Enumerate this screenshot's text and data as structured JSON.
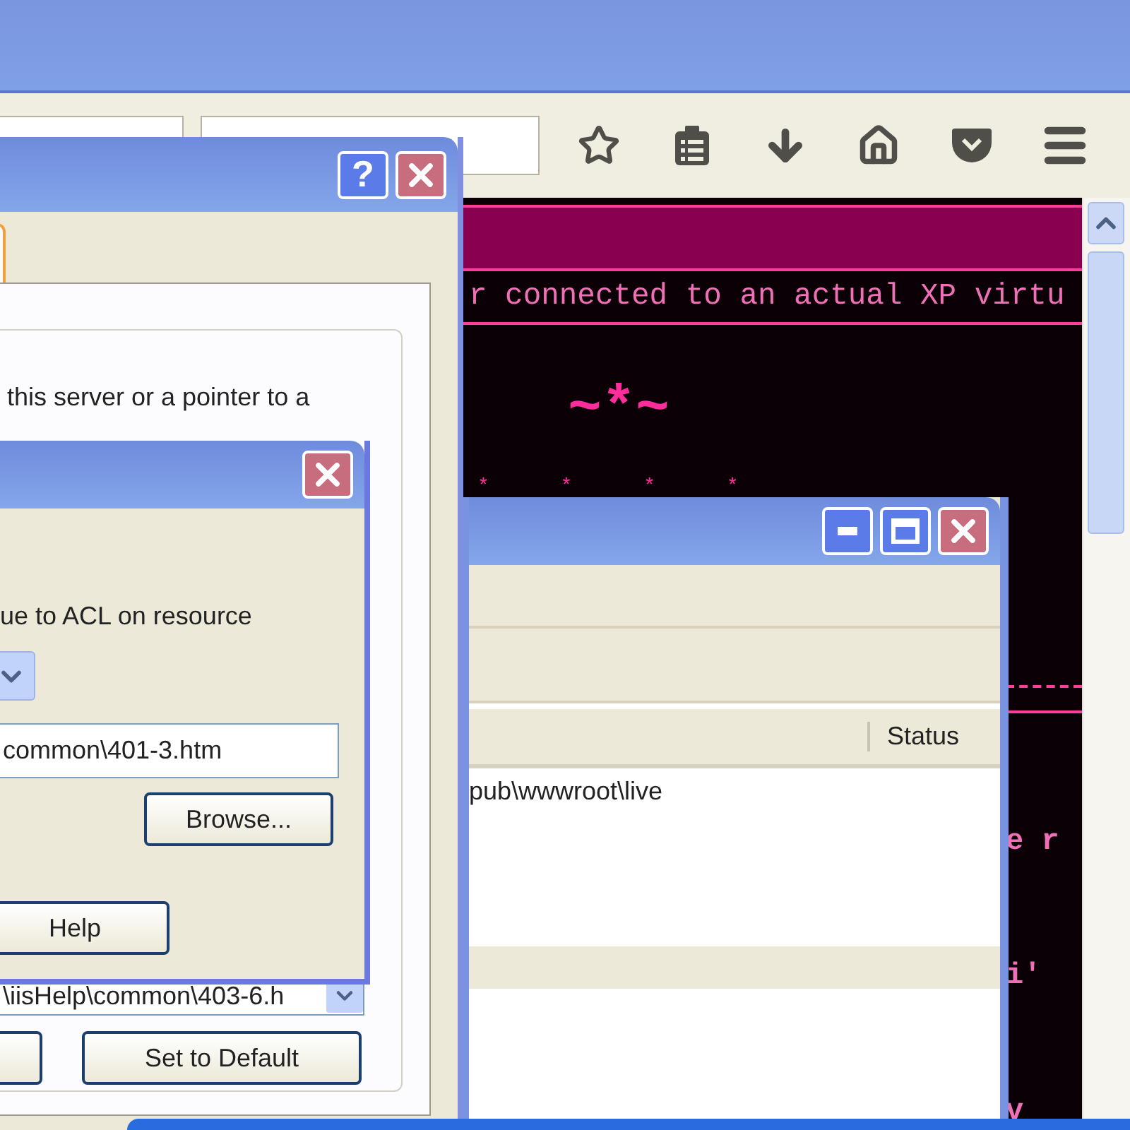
{
  "page": {
    "banner_text": "r connected to an actual XP virtu",
    "art": "~*~",
    "stars": "*      *      *      *",
    "fragments": [
      "e r",
      "i'",
      "v"
    ]
  },
  "properties_dialog": {
    "help_glyph": "?",
    "description": "this server or a pointer to a",
    "path_value": "\\iisHelp\\common\\403-6.h",
    "buttons": [
      "Set to Default"
    ]
  },
  "error_dialog": {
    "description": "ue to ACL on resource",
    "file_value": "common\\401-3.htm",
    "buttons": [
      "Browse...",
      "Help"
    ]
  },
  "manager_window": {
    "columns": [
      "Status"
    ],
    "rows": [
      {
        "path": "pub\\wwwroot\\live",
        "selected": false
      }
    ]
  }
}
